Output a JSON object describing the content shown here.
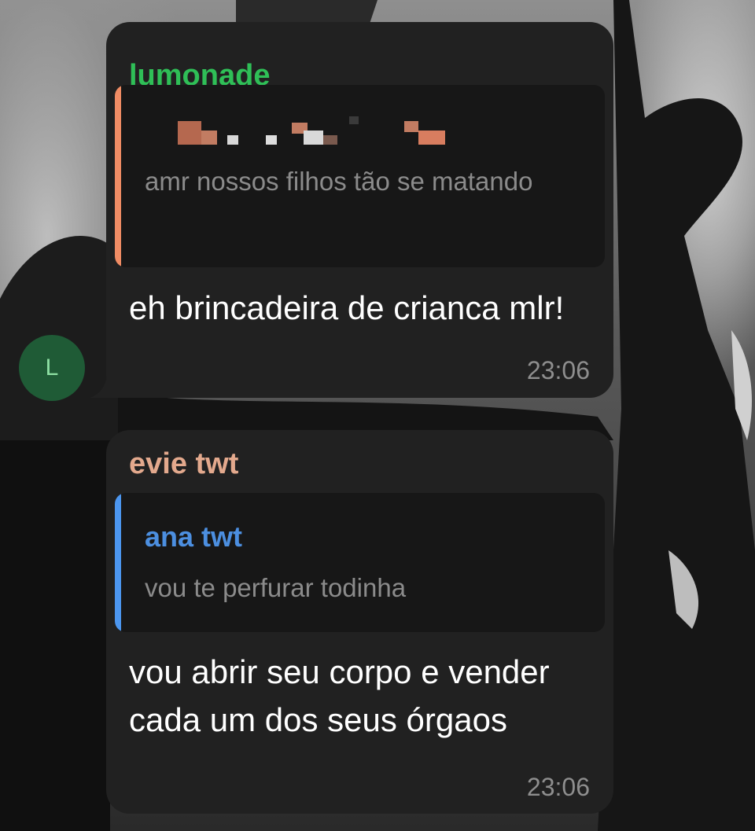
{
  "colors": {
    "bubble_bg": "#212121",
    "quote_bg": "#171717",
    "sender1": "#2fbf57",
    "sender2": "#e3a98d",
    "quote_bar1": "#f08c64",
    "quote_bar2": "#4c96ef",
    "quote_author2": "#4c8fe0",
    "avatar_bg": "#1f5b36"
  },
  "avatar": {
    "initial": "L"
  },
  "messages": [
    {
      "sender": "lumonade",
      "reply": {
        "author": "",
        "author_censored": true,
        "text": "amr nossos filhos tão se matando"
      },
      "text": "eh brincadeira de crianca mlr!",
      "time": "23:06"
    },
    {
      "sender": "evie twt",
      "reply": {
        "author": "ana twt",
        "text": "vou te perfurar todinha"
      },
      "text": "vou abrir seu corpo e vender cada um dos seus órgaos",
      "time": "23:06"
    }
  ]
}
